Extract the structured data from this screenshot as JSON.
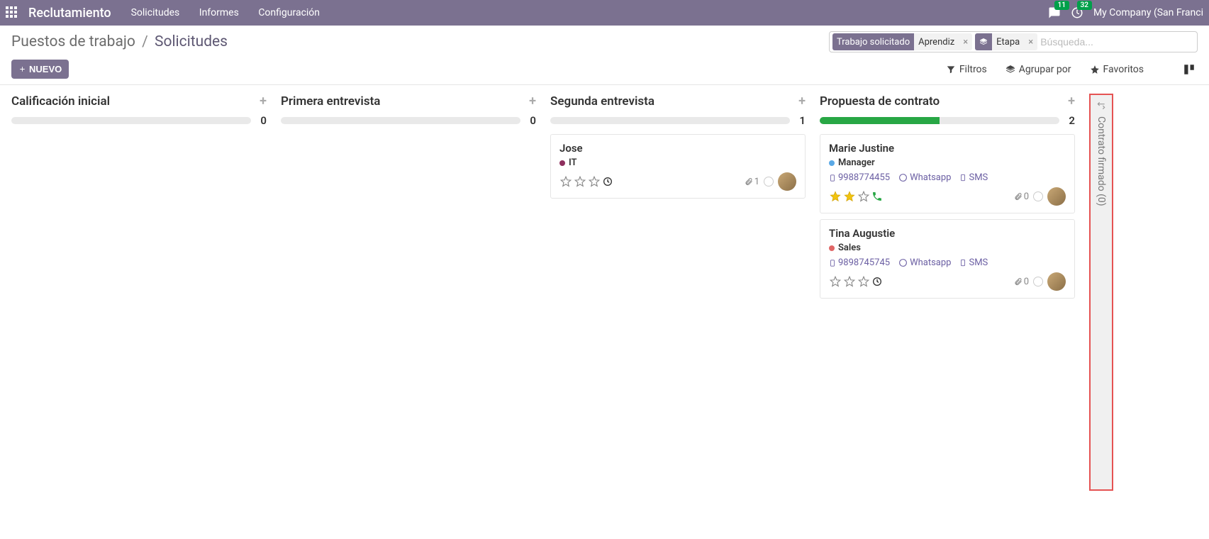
{
  "navbar": {
    "brand": "Reclutamiento",
    "menu": [
      "Solicitudes",
      "Informes",
      "Configuración"
    ],
    "messages_count": "11",
    "activities_count": "32",
    "company": "My Company (San Franci"
  },
  "breadcrumb": {
    "parent": "Puestos de trabajo",
    "current": "Solicitudes"
  },
  "search": {
    "facets": [
      {
        "label": "Trabajo solicitado",
        "value": "Aprendiz",
        "icon": null
      },
      {
        "label": "",
        "value": "Etapa",
        "icon": "layers"
      }
    ],
    "placeholder": "Búsqueda..."
  },
  "buttons": {
    "new": "NUEVO"
  },
  "toolbar": {
    "filters": "Filtros",
    "groupby": "Agrupar por",
    "favorites": "Favoritos"
  },
  "columns": [
    {
      "title": "Calificación inicial",
      "count": "0",
      "progress_pct": 0,
      "cards": []
    },
    {
      "title": "Primera entrevista",
      "count": "0",
      "progress_pct": 0,
      "cards": []
    },
    {
      "title": "Segunda entrevista",
      "count": "1",
      "progress_pct": 0,
      "cards": [
        {
          "name": "Jose",
          "tag_color": "#8e2f5e",
          "tag_text": "IT",
          "stars": 0,
          "extra_icon": "clock",
          "attachments": "1"
        }
      ]
    },
    {
      "title": "Propuesta de contrato",
      "count": "2",
      "progress_pct": 50,
      "cards": [
        {
          "name": "Marie Justine",
          "tag_color": "#5aa9e6",
          "tag_text": "Manager",
          "phone": "9988774455",
          "whatsapp": "Whatsapp",
          "sms": "SMS",
          "stars": 2,
          "extra_icon": "phone",
          "attachments": "0"
        },
        {
          "name": "Tina Augustie",
          "tag_color": "#e06666",
          "tag_text": "Sales",
          "phone": "9898745745",
          "whatsapp": "Whatsapp",
          "sms": "SMS",
          "stars": 0,
          "extra_icon": "clock",
          "attachments": "0"
        }
      ]
    }
  ],
  "collapsed": {
    "title": "Contrato firmado (0)"
  }
}
